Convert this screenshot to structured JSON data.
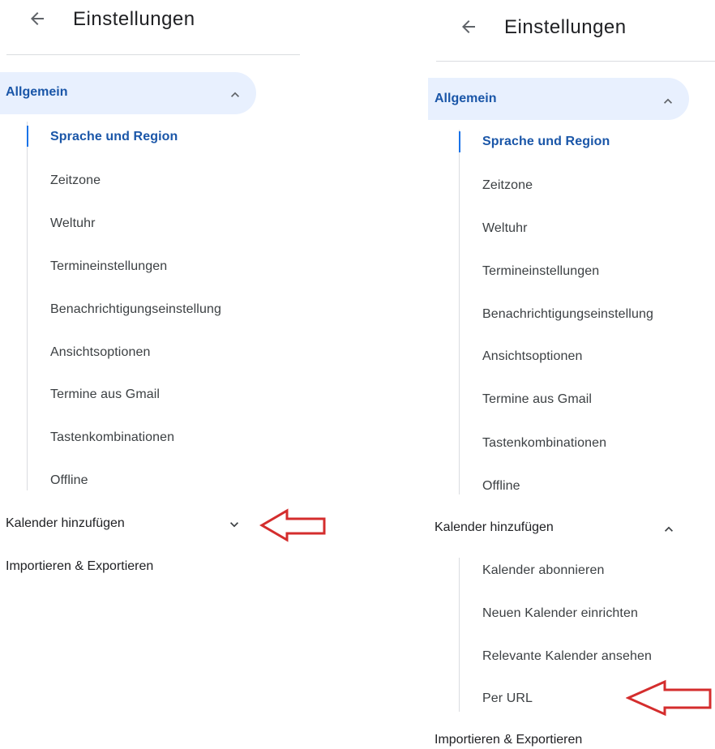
{
  "left": {
    "header_title": "Einstellungen",
    "section_general": "Allgemein",
    "general_items": [
      "Sprache und Region",
      "Zeitzone",
      "Weltuhr",
      "Termineinstellungen",
      "Benachrichtigungseinstellung",
      "Ansichtsoptionen",
      "Termine aus Gmail",
      "Tastenkombinationen",
      "Offline"
    ],
    "section_add_calendar": "Kalender hinzufügen",
    "section_import_export": "Importieren & Exportieren"
  },
  "right": {
    "header_title": "Einstellungen",
    "section_general": "Allgemein",
    "general_items": [
      "Sprache und Region",
      "Zeitzone",
      "Weltuhr",
      "Termineinstellungen",
      "Benachrichtigungseinstellung",
      "Ansichtsoptionen",
      "Termine aus Gmail",
      "Tastenkombinationen",
      "Offline"
    ],
    "section_add_calendar": "Kalender hinzufügen",
    "add_calendar_items": [
      "Kalender abonnieren",
      "Neuen Kalender einrichten",
      "Relevante Kalender ansehen",
      "Per URL"
    ],
    "section_import_export": "Importieren & Exportieren"
  },
  "colors": {
    "accent_blue": "#1a73e8",
    "active_text": "#1a56a8",
    "active_bg": "#e8f0fe",
    "annotation_arrow": "#d42d2d"
  },
  "icons": {
    "back": "arrow-left-icon",
    "expand": "chevron-down-icon",
    "collapse": "chevron-up-icon",
    "annotation": "red-outline-arrow"
  }
}
